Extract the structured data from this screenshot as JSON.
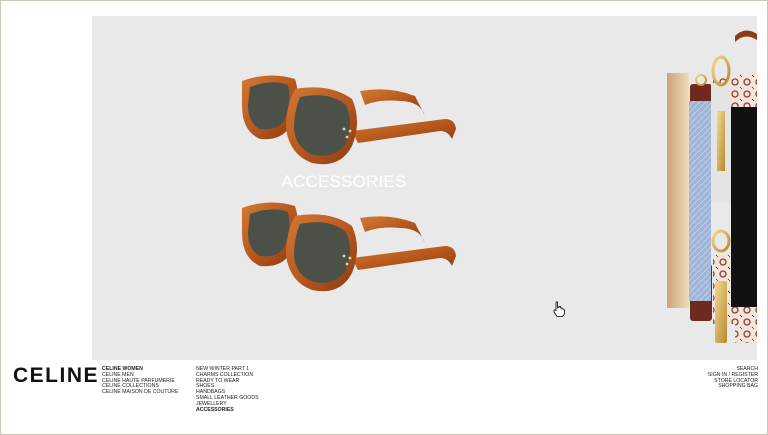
{
  "hero": {
    "title": "ACCESSORIES"
  },
  "logo": "CELINE",
  "nav_primary": [
    {
      "label": "CELINE WOMEN",
      "active": true
    },
    {
      "label": "CELINE MEN",
      "active": false
    },
    {
      "label": "CELINE HAUTE PARFUMERIE",
      "active": false
    },
    {
      "label": "CELINE COLLECTIONS",
      "active": false
    },
    {
      "label": "CELINE MAISON DE COUTURE",
      "active": false
    }
  ],
  "nav_secondary": [
    {
      "label": "NEW WINTER PART 1",
      "active": false
    },
    {
      "label": "CHARMS COLLECTION",
      "active": false
    },
    {
      "label": "READY TO WEAR",
      "active": false
    },
    {
      "label": "SHOES",
      "active": false
    },
    {
      "label": "HANDBAGS",
      "active": false
    },
    {
      "label": "SMALL LEATHER GOODS",
      "active": false
    },
    {
      "label": "JEWELLERY",
      "active": false
    },
    {
      "label": "ACCESSORIES",
      "active": true
    }
  ],
  "nav_utility": [
    {
      "label": "SEARCH"
    },
    {
      "label": "SIGN IN / REGISTER"
    },
    {
      "label": "STORE LOCATOR"
    },
    {
      "label": "SHOPPING BAG"
    }
  ],
  "colors": {
    "hero_bg": "#e9e9e9",
    "tortoise": "#b8591e",
    "lens": "#4b5148",
    "canvas_bg": "#f1e5dc",
    "canvas_pattern": "#9b3a2a",
    "gold": "#c9a24a",
    "denim": "#9fb4d6",
    "black": "#111111"
  },
  "icons": [
    "hand-cursor-icon"
  ]
}
